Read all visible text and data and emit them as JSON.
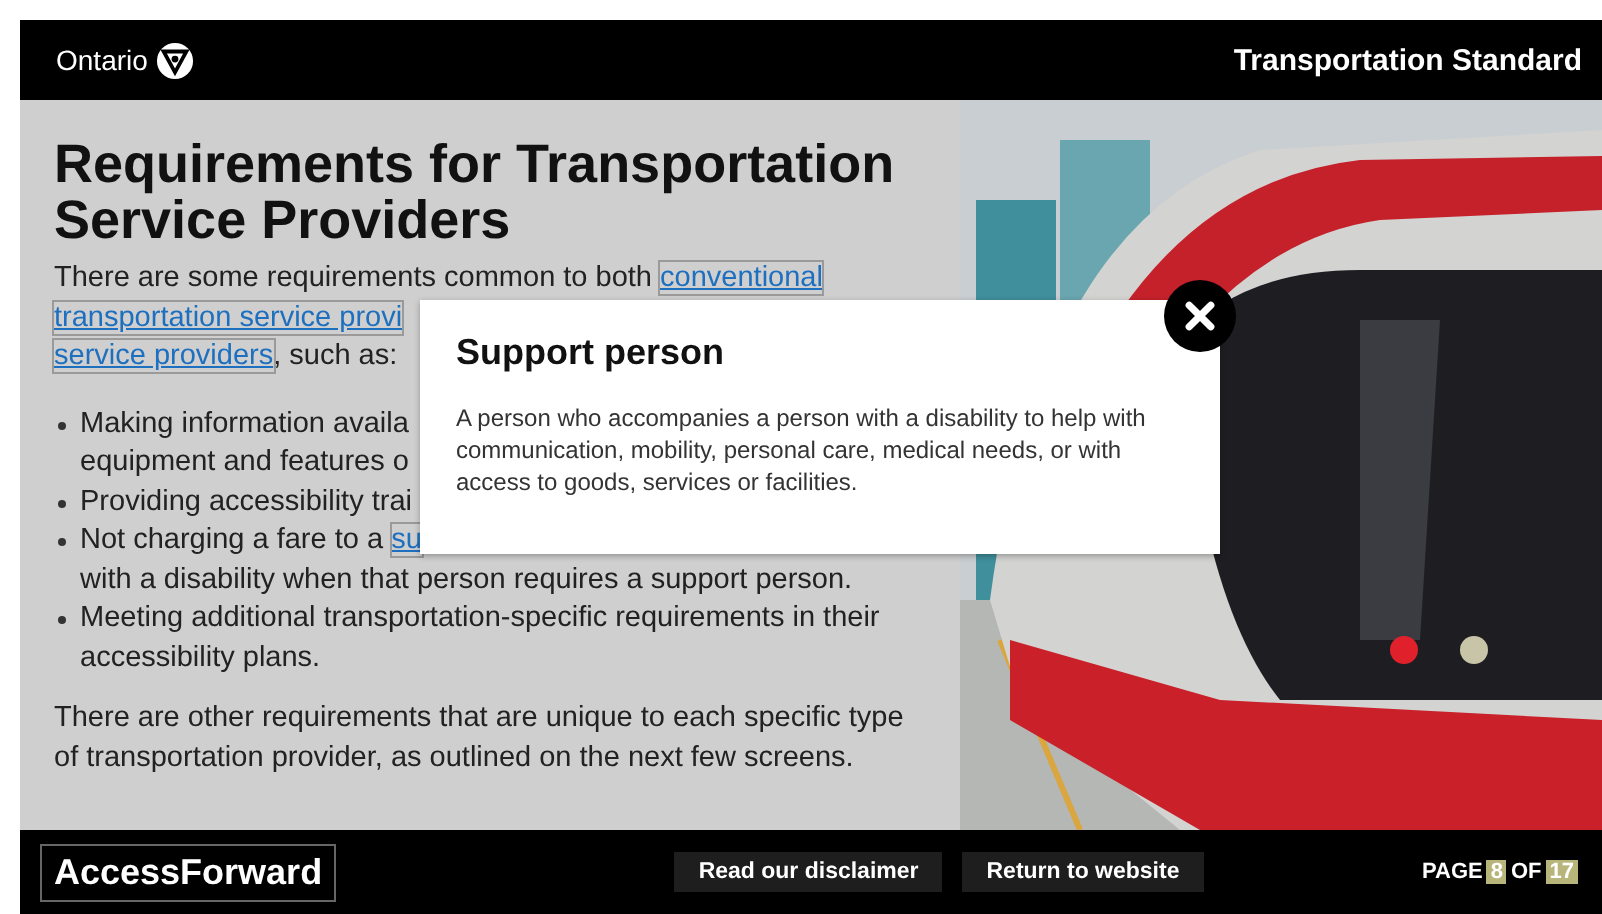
{
  "header": {
    "logo_text": "Ontario",
    "title": "Transportation Standard"
  },
  "heading": "Requirements for Transportation Service Providers",
  "intro_lines": [
    [
      {
        "text": "There are some requirements common to both ",
        "link": false
      },
      {
        "text": "conventional",
        "link": true
      }
    ],
    [
      {
        "text": "transportation service provi",
        "link": true
      }
    ],
    [
      {
        "text": "service providers",
        "link": true
      },
      {
        "text": ", such as:",
        "link": false
      }
    ]
  ],
  "bullets": [
    {
      "lines": [
        [
          {
            "text": "Making information availa",
            "link": false
          }
        ],
        [
          {
            "text": "equipment and features o",
            "link": false
          }
        ]
      ]
    },
    {
      "lines": [
        [
          {
            "text": "Providing accessibility trai",
            "link": false
          }
        ]
      ]
    },
    {
      "lines": [
        [
          {
            "text": "Not charging a fare to a ",
            "link": false
          },
          {
            "text": "su",
            "link": true
          }
        ],
        [
          {
            "text": "with a disability when that person requires a support person.",
            "link": false
          }
        ]
      ]
    },
    {
      "lines": [
        [
          {
            "text": "Meeting additional transportation-specific requirements in their",
            "link": false
          }
        ],
        [
          {
            "text": "accessibility plans.",
            "link": false
          }
        ]
      ]
    }
  ],
  "closing": "There are other requirements that are unique to each specific type of transportation provider, as outlined on the next few screens.",
  "photo": {
    "kind": "picture"
  },
  "modal": {
    "title": "Support person",
    "body": "A person who accompanies a person with a disability to help with communication, mobility, personal care, medical needs, or with access to goods, services or facilities."
  },
  "footer": {
    "brand": "AccessForward",
    "buttons": [
      "Read our disclaimer",
      "Return to website"
    ],
    "page_label": "PAGE",
    "page_current": "8",
    "of_label": "OF",
    "page_total": "17"
  }
}
